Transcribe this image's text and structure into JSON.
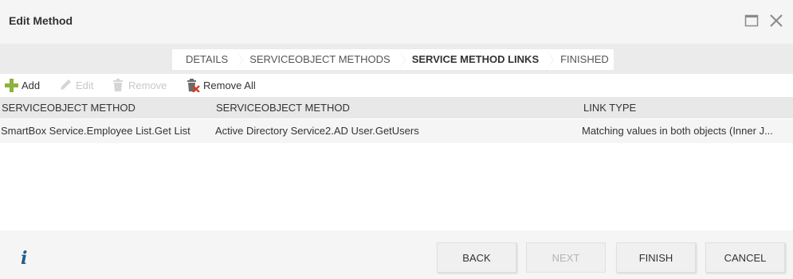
{
  "window": {
    "title": "Edit Method",
    "maximize_icon": "maximize-icon",
    "close_icon": "close-icon"
  },
  "wizard": {
    "steps": [
      {
        "label": "DETAILS",
        "active": false
      },
      {
        "label": "SERVICEOBJECT METHODS",
        "active": false
      },
      {
        "label": "SERVICE METHOD LINKS",
        "active": true
      },
      {
        "label": "FINISHED",
        "active": false
      }
    ]
  },
  "toolbar": {
    "add_label": "Add",
    "edit_label": "Edit",
    "remove_label": "Remove",
    "remove_all_label": "Remove All"
  },
  "grid": {
    "columns": [
      "SERVICEOBJECT METHOD",
      "SERVICEOBJECT METHOD",
      "LINK TYPE"
    ],
    "rows": [
      [
        "SmartBox Service.Employee List.Get List",
        "Active Directory Service2.AD User.GetUsers",
        "Matching values in both objects (Inner J..."
      ]
    ]
  },
  "footer": {
    "info_icon": "info-icon",
    "back_label": "BACK",
    "next_label": "NEXT",
    "finish_label": "FINISH",
    "cancel_label": "CANCEL"
  },
  "colors": {
    "add_icon": "#8cb33a",
    "remove_all_x": "#d23b2b",
    "info_icon": "#1e5e8a"
  }
}
